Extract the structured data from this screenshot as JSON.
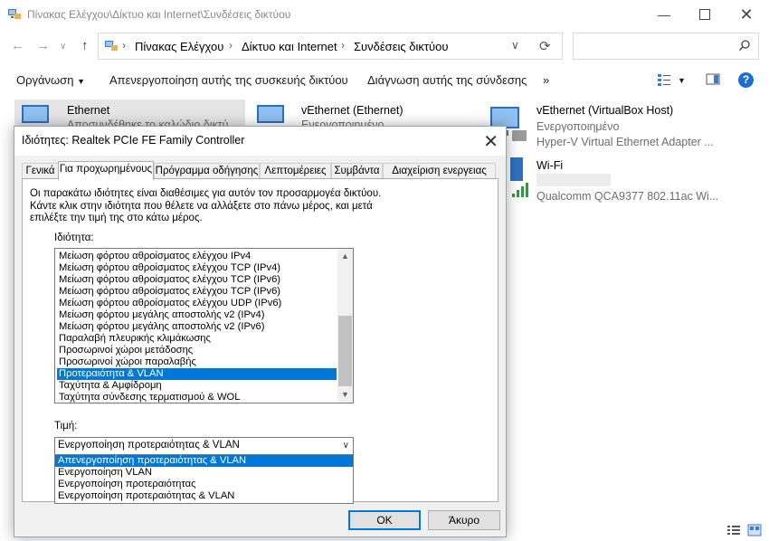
{
  "explorer": {
    "title": "Πίνακας Ελέγχου\\Δίκτυο και Internet\\Συνδέσεις δικτύου",
    "breadcrumb": [
      "Πίνακας Ελέγχου",
      "Δίκτυο και Internet",
      "Συνδέσεις δικτύου"
    ],
    "toolbar": {
      "organize": "Οργάνωση",
      "disable_device": "Απενεργοποίηση αυτής της συσκευής δικτύου",
      "diagnose": "Διάγνωση αυτής της σύνδεσης",
      "more": "»"
    },
    "connections": [
      {
        "name": "Ethernet",
        "status": "Αποσυνδέθηκε το καλώδιο δικτύ"
      },
      {
        "name": "vEthernet (Ethernet)",
        "status": "Ενεργοποιημένο"
      },
      {
        "name": "vEthernet (VirtualBox Host)",
        "status": "Ενεργοποιημένο",
        "adapter": "Hyper-V Virtual Ethernet Adapter ..."
      },
      {
        "name": "Wi-Fi",
        "adapter": "Qualcomm QCA9377 802.11ac Wi..."
      }
    ]
  },
  "dialog": {
    "title": "Ιδιότητες: Realtek PCIe FE Family Controller",
    "tabs": [
      "Γενικά",
      "Για προχωρημένους",
      "Πρόγραμμα οδήγησης",
      "Λεπτομέρειες",
      "Συμβάντα",
      "Διαχείριση ενεργειας"
    ],
    "active_tab": "Για προχωρημένους",
    "description": "Οι παρακάτω ιδιότητες είναι διαθέσιμες για αυτόν τον προσαρμογέα δικτύου. Κάντε κλικ στην ιδιότητα που θέλετε να αλλάξετε στο πάνω μέρος, και μετά επιλέξτε την τιμή της στο κάτω μέρος.",
    "property_label": "Ιδιότητα:",
    "properties": [
      "Μείωση φόρτου αθροίσματος ελέγχου IPv4",
      "Μείωση φόρτου αθροίσματος ελέγχου TCP (IPv4)",
      "Μείωση φόρτου αθροίσματος ελέγχου TCP (IPv6)",
      "Μείωση φόρτου αθροίσματος ελέγχου TCP (IPv6)",
      "Μείωση φόρτου αθροίσματος ελέγχου UDP (IPv6)",
      "Μείωση φόρτου μεγάλης αποστολής v2 (IPv4)",
      "Μείωση φόρτου μεγάλης αποστολής v2 (IPv6)",
      "Παραλαβή πλευρικής κλιμάκωσης",
      "Προσωρινοί χώροι μετάδοσης",
      "Προσωρινοί χώροι παραλαβής",
      "Προτεραιότητα & VLAN",
      "Ταχύτητα & Αμφίδρομη",
      "Ταχύτητα σύνδεσης τερματισμού & WOL"
    ],
    "selected_property": "Προτεραιότητα & VLAN",
    "value_label": "Τιμή:",
    "value": "Ενεργοποίηση προτεραιότητας & VLAN",
    "value_options": [
      "Απενεργοποίηση προτεραιότητας & VLAN",
      "Ενεργοποίηση VLAN",
      "Ενεργοποίηση προτεραιότητας",
      "Ενεργοποίηση προτεραιότητας & VLAN"
    ],
    "highlighted_option": "Απενεργοποίηση προτεραιότητας & VLAN",
    "ok": "OK",
    "cancel": "Άκυρο"
  },
  "colors": {
    "selection": "#0078d7",
    "dialog_bg": "#f0f0f0",
    "help_icon": "#1a6fd0"
  }
}
